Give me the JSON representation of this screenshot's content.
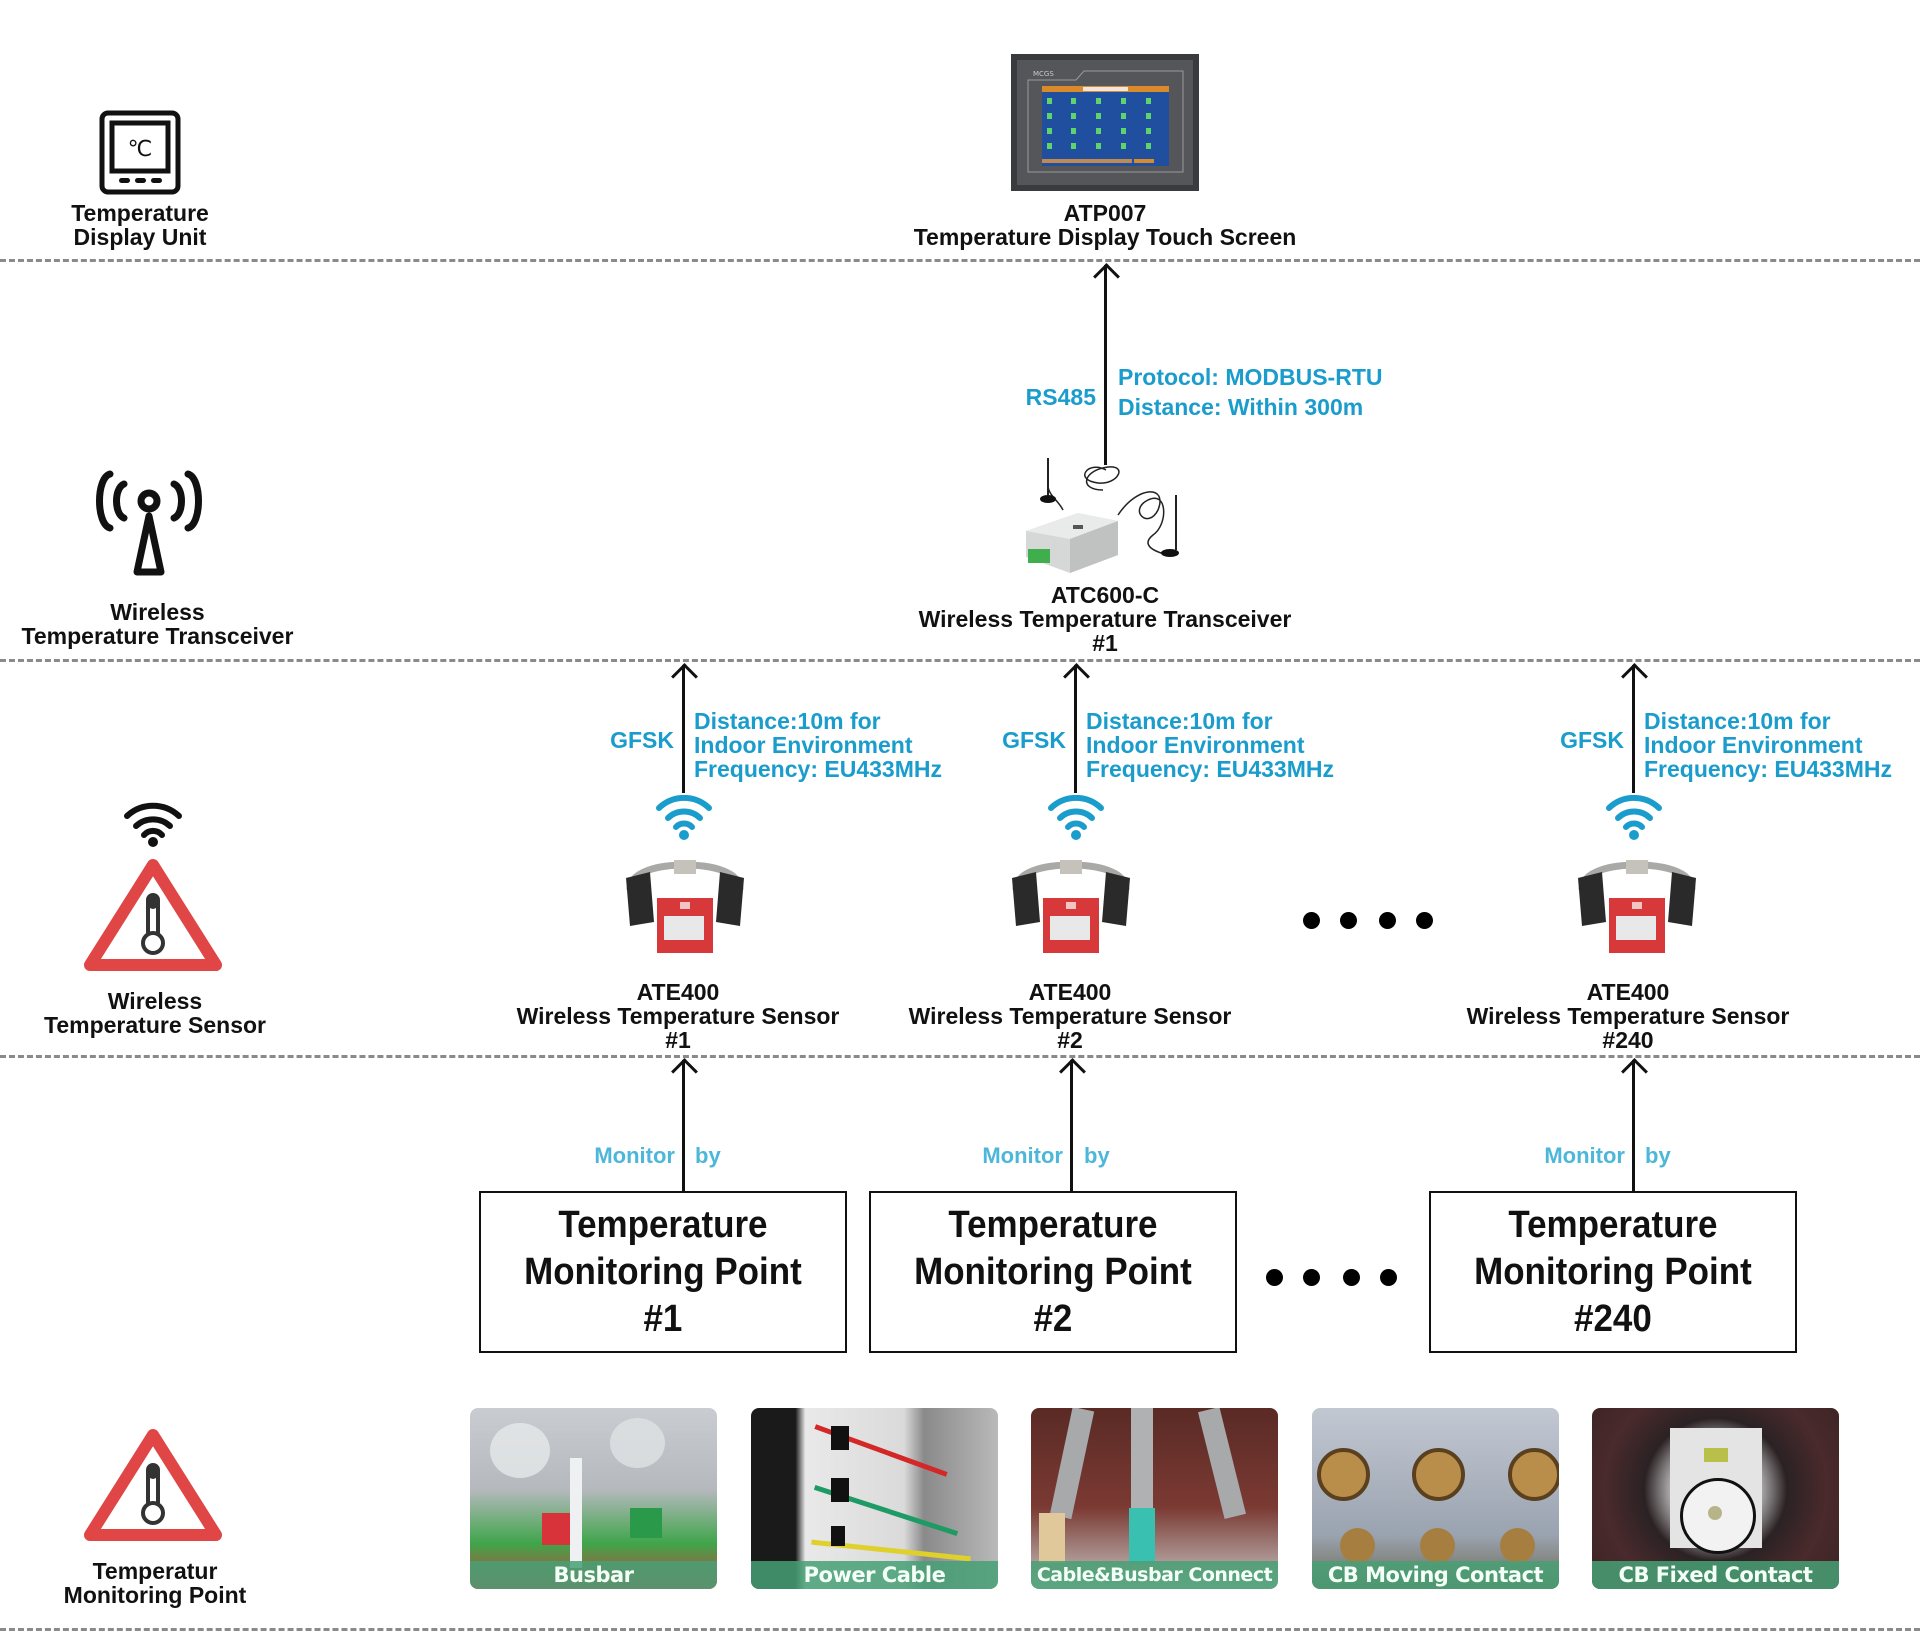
{
  "layers": [
    {
      "name": "display",
      "left_label": [
        "Temperature",
        "Display Unit"
      ]
    },
    {
      "name": "transceiver",
      "left_label": [
        "Wireless",
        "Temperature Transceiver"
      ]
    },
    {
      "name": "sensor",
      "left_label": [
        "Wireless",
        "Temperature Sensor"
      ]
    },
    {
      "name": "monitoring",
      "left_label": [
        "Temperatur",
        "Monitoring Point"
      ]
    }
  ],
  "display": {
    "model": "ATP007",
    "title": "Temperature Display Touch Screen",
    "screen_brand": "MCGS"
  },
  "link_display": {
    "left": "RS485",
    "right": [
      "Protocol: MODBUS-RTU",
      "Distance: Within 300m"
    ]
  },
  "transceiver": {
    "model": "ATC600-C",
    "title": "Wireless Temperature Transceiver",
    "index": "#1"
  },
  "sensors": [
    {
      "model": "ATE400",
      "title": "Wireless Temperature Sensor",
      "index": "#1",
      "link_left": "GFSK",
      "link_right": [
        "Distance:10m for",
        "Indoor Environment",
        "Frequency: EU433MHz"
      ]
    },
    {
      "model": "ATE400",
      "title": "Wireless Temperature Sensor",
      "index": "#2",
      "link_left": "GFSK",
      "link_right": [
        "Distance:10m for",
        "Indoor Environment",
        "Frequency: EU433MHz"
      ]
    },
    {
      "model": "ATE400",
      "title": "Wireless Temperature Sensor",
      "index": "#240",
      "link_left": "GFSK",
      "link_right": [
        "Distance:10m for",
        "Indoor Environment",
        "Frequency: EU433MHz"
      ]
    }
  ],
  "monitor_link": {
    "left": "Monitor",
    "right": "by"
  },
  "points": [
    {
      "lines": [
        "Temperature",
        "Monitoring Point",
        "#1"
      ]
    },
    {
      "lines": [
        "Temperature",
        "Monitoring Point",
        "#2"
      ]
    },
    {
      "lines": [
        "Temperature",
        "Monitoring Point",
        "#240"
      ]
    }
  ],
  "photos": [
    {
      "caption": "Busbar"
    },
    {
      "caption": "Power Cable"
    },
    {
      "caption": "Cable&Busbar Connect"
    },
    {
      "caption": "CB Moving Contact"
    },
    {
      "caption": "CB Fixed Contact"
    }
  ],
  "colors": {
    "link_text": "#1a9ccc",
    "monitor_text": "#4db7d9",
    "warning_red": "#e04646",
    "caption_green": "#48a076",
    "divider": "#8a8a8a"
  }
}
